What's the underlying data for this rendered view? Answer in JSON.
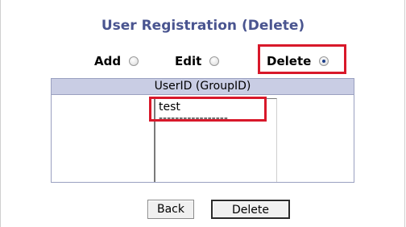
{
  "page": {
    "title": "User Registration (Delete)"
  },
  "modes": [
    {
      "label": "Add",
      "checked": false
    },
    {
      "label": "Edit",
      "checked": false
    },
    {
      "label": "Delete",
      "checked": true
    }
  ],
  "list": {
    "header": "UserID (GroupID)",
    "options": [
      "test",
      "-----------------"
    ]
  },
  "buttons": {
    "back": "Back",
    "delete": "Delete"
  },
  "colors": {
    "title": "#4a5590",
    "header_bg": "#c9cde4",
    "highlight": "#d8182a"
  }
}
